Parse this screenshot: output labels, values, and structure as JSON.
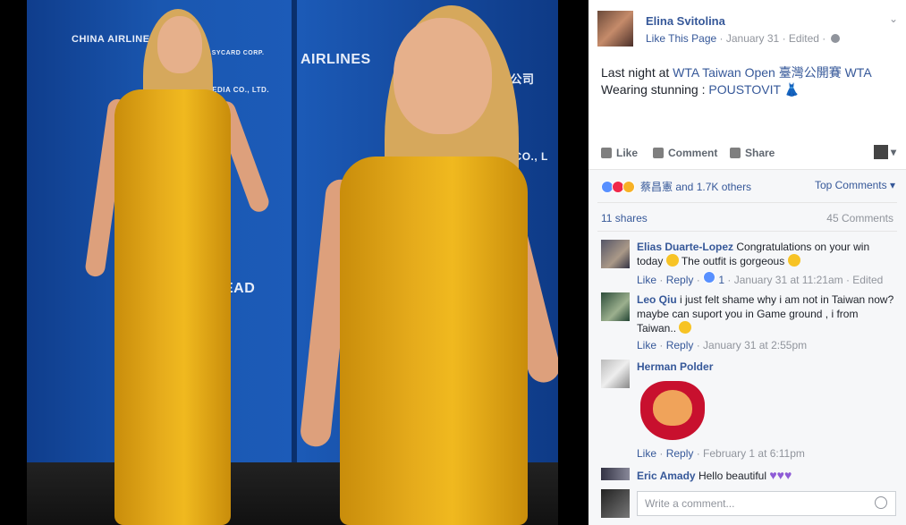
{
  "post": {
    "author": "Elina Svitolina",
    "meta_link": "Like This Page",
    "meta_date": "January 31",
    "meta_edited": "Edited",
    "text_prefix": "Last night at ",
    "text_link1": "WTA Taiwan Open 臺灣公開賽 WTA",
    "text_line2_prefix": "Wearing stunning : ",
    "text_link2": "POUSTOVIT"
  },
  "actions": {
    "like": "Like",
    "comment": "Comment",
    "share": "Share"
  },
  "reactions": {
    "names": "蔡昌憲 and 1.7K others",
    "top_comments": "Top Comments"
  },
  "stats": {
    "shares": "11 shares",
    "comments": "45 Comments"
  },
  "comments": [
    {
      "author": "Elias Duarte-Lopez",
      "text_a": "Congratulations on your win today",
      "text_b": "The outfit is gorgeous",
      "like": "Like",
      "reply": "Reply",
      "likes": "1",
      "date": "January 31 at 11:21am",
      "edited": "Edited"
    },
    {
      "author": "Leo Qiu",
      "text": "i just felt shame why i am not in Taiwan now? maybe can suport you in Game ground , i from Taiwan..",
      "like": "Like",
      "reply": "Reply",
      "date": "January 31 at 2:55pm"
    },
    {
      "author": "Herman Polder",
      "like": "Like",
      "reply": "Reply",
      "date": "February 1 at 6:11pm"
    },
    {
      "author": "Eric Amady",
      "text": "Hello beautiful"
    }
  ],
  "composer": {
    "placeholder": "Write a comment..."
  },
  "photo": {
    "logos": [
      "CHINA AIRLINE",
      "AIRLINES",
      "EASYCARD CORP.",
      "MEDIA CO., LTD.",
      "EAD",
      "MEDIA CO., L",
      "悠遊卡公司"
    ]
  },
  "colors": {
    "link": "#365899",
    "muted": "#90949c",
    "backdrop": "#1a57b0",
    "dress": "#e6ac1c"
  }
}
